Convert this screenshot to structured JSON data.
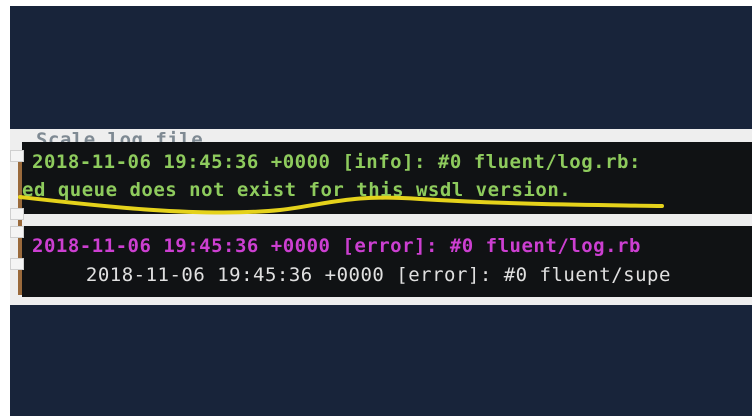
{
  "terminal": {
    "top_partial": "Scale log file",
    "lines": [
      "2018-11-06 19:45:36 +0000 [info]: #0 fluent/log.rb:",
      "ed queue does not exist for this wsdl version.",
      "2018-11-06 19:45:36 +0000 [error]: #0 fluent/log.rb",
      "  2018-11-06 19:45:36 +0000 [error]: #0 fluent/supe"
    ],
    "colors": {
      "info": "#8ecb5d",
      "error": "#cc3fd1",
      "trace": "#e0e0e0",
      "highlight": "#e5d21b"
    }
  }
}
